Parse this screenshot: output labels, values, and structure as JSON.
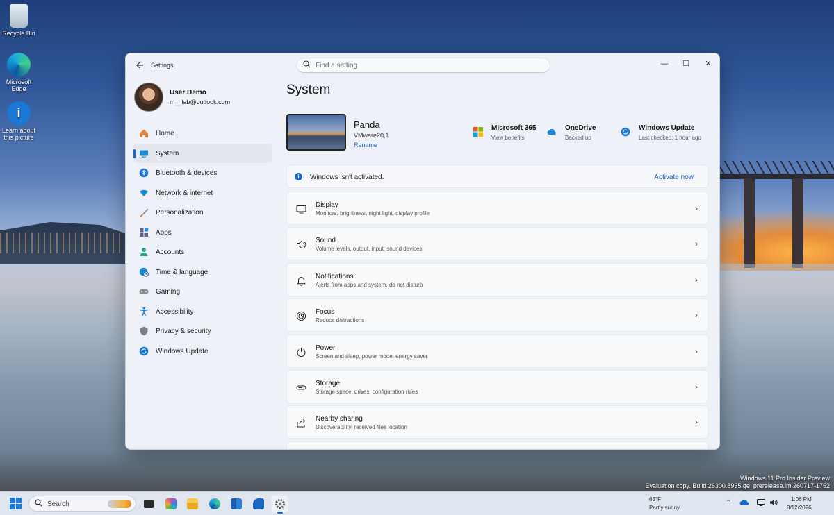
{
  "desktop": {
    "icons": [
      {
        "label": "Recycle Bin"
      },
      {
        "label_line1": "Microsoft",
        "label_line2": "Edge"
      },
      {
        "label_line1": "Learn about",
        "label_line2": "this picture"
      }
    ],
    "watermark_line1": "Windows 11 Pro Insider Preview",
    "watermark_line2": "Evaluation copy. Build 26300.8935.ge_prerelease.im.260717-1752"
  },
  "window": {
    "app_title": "Settings",
    "search_placeholder": "Find a setting",
    "controls": {
      "minimize": "—",
      "maximize": "☐",
      "close": "✕"
    }
  },
  "profile": {
    "name": "User Demo",
    "email": "m__lab@outlook.com"
  },
  "nav": [
    {
      "label": "Home",
      "icon": "home-icon",
      "color": "#e8833a"
    },
    {
      "label": "System",
      "icon": "system-icon",
      "color": "#1a8ad4",
      "active": true
    },
    {
      "label": "Bluetooth & devices",
      "icon": "bluetooth-icon",
      "color": "#1a78d6"
    },
    {
      "label": "Network & internet",
      "icon": "wifi-icon",
      "color": "#1a8ad4"
    },
    {
      "label": "Personalization",
      "icon": "brush-icon",
      "color": "#d4782a"
    },
    {
      "label": "Apps",
      "icon": "apps-icon",
      "color": "#5a6a86"
    },
    {
      "label": "Accounts",
      "icon": "accounts-icon",
      "color": "#2aa58a"
    },
    {
      "label": "Time & language",
      "icon": "globe-clock-icon",
      "color": "#1a8ad4"
    },
    {
      "label": "Gaming",
      "icon": "gamepad-icon",
      "color": "#8a8a8a"
    },
    {
      "label": "Accessibility",
      "icon": "accessibility-icon",
      "color": "#1a78d6"
    },
    {
      "label": "Privacy & security",
      "icon": "shield-icon",
      "color": "#7a7f88"
    },
    {
      "label": "Windows Update",
      "icon": "update-icon",
      "color": "#1a78d6"
    }
  ],
  "main": {
    "title": "System",
    "device": {
      "name": "Panda",
      "model": "VMware20,1",
      "rename": "Rename"
    },
    "quick_links": [
      {
        "title": "Microsoft 365",
        "sub": "View benefits",
        "icon": "microsoft-365-icon"
      },
      {
        "title": "OneDrive",
        "sub": "Backed up",
        "icon": "onedrive-icon"
      },
      {
        "title": "Windows Update",
        "sub": "Last checked: 1 hour ago",
        "icon": "update-icon"
      }
    ],
    "activation": {
      "text": "Windows isn't activated.",
      "action": "Activate now"
    },
    "settings": [
      {
        "title": "Display",
        "sub": "Monitors, brightness, night light, display profile",
        "icon": "display-icon"
      },
      {
        "title": "Sound",
        "sub": "Volume levels, output, input, sound devices",
        "icon": "speaker-icon"
      },
      {
        "title": "Notifications",
        "sub": "Alerts from apps and system, do not disturb",
        "icon": "bell-icon"
      },
      {
        "title": "Focus",
        "sub": "Reduce distractions",
        "icon": "focus-icon"
      },
      {
        "title": "Power",
        "sub": "Screen and sleep, power mode, energy saver",
        "icon": "power-icon"
      },
      {
        "title": "Storage",
        "sub": "Storage space, drives, configuration rules",
        "icon": "storage-icon"
      },
      {
        "title": "Nearby sharing",
        "sub": "Discoverability, received files location",
        "icon": "share-icon"
      }
    ]
  },
  "taskbar": {
    "search_label": "Search",
    "weather_temp": "65°F",
    "weather_desc": "Partly sunny",
    "time": "1:06 PM",
    "date": "8/12/2026"
  }
}
